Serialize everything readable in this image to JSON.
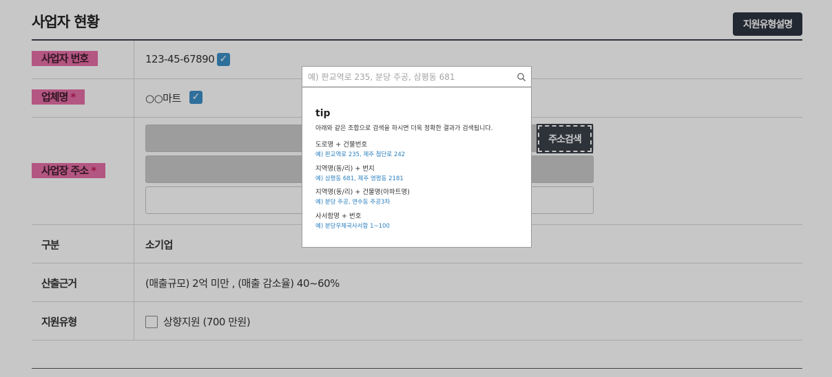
{
  "section": {
    "title": "사업자 현황",
    "type_button": "지원유형설명"
  },
  "rows": {
    "biz_number": {
      "label": "사업자 번호",
      "value": "123-45-67890"
    },
    "company": {
      "label": "업체명",
      "required_mark": "*",
      "value": "○○마트"
    },
    "address": {
      "label": "사업장 주소",
      "required_mark": "*",
      "search_button": "주소검색"
    },
    "category": {
      "label": "구분",
      "value": "소기업"
    },
    "basis": {
      "label": "산출근거",
      "value": "(매출규모) 2억 미만 , (매출 감소율) 40~60%"
    },
    "support_type": {
      "label": "지원유형",
      "option": "상향지원 (700 만원)"
    }
  },
  "popup": {
    "search_placeholder": "예) 판교역로 235, 분당 주공, 삼평동 681",
    "tip_title": "tip",
    "tip_desc": "아래와 같은 조합으로 검색을 하시면 더욱 정확한 결과가 검색됩니다.",
    "tips": [
      {
        "head": "도로명 + 건물번호",
        "example": "예) 판교역로 235,  제주 첨단로 242"
      },
      {
        "head": "지역명(동/리) + 번지",
        "example": "예) 삼평동 681,  제주 영평동 2181"
      },
      {
        "head": "지역명(동/리) + 건물명(아파트명)",
        "example": "예) 분당 주공,  연수동 주공3차"
      },
      {
        "head": "사서함명 + 번호",
        "example": "예) 분당우체국사서함 1~100"
      }
    ]
  },
  "colors": {
    "label_pink": "#e66fa6",
    "check_blue": "#3d8fc7",
    "dark_button": "#2d3540",
    "tip_example_blue": "#2a7fbf"
  },
  "icons": {
    "check": "checkmark-icon",
    "search": "search-icon"
  }
}
